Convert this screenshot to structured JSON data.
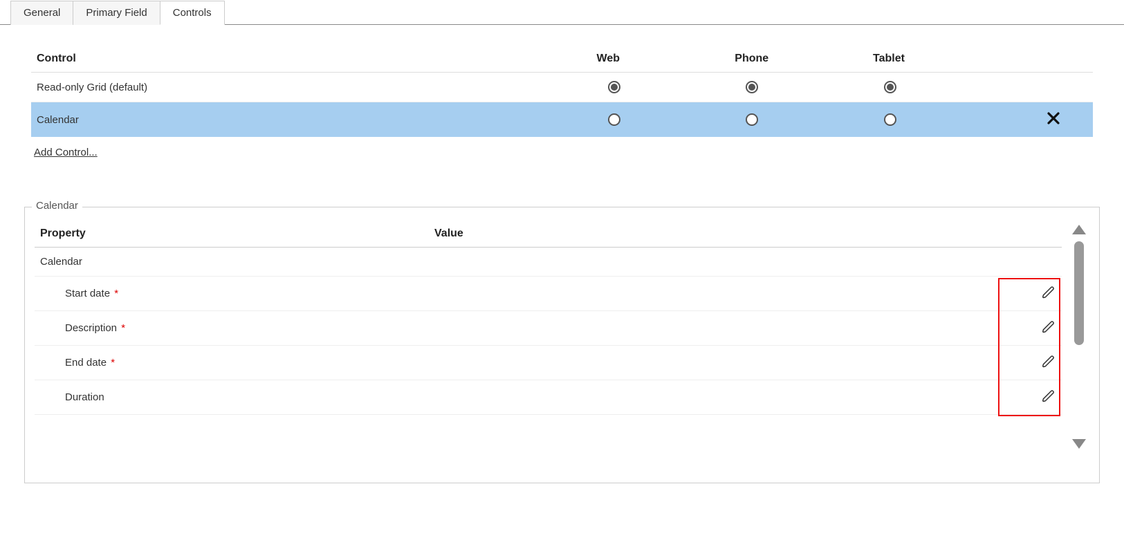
{
  "tabs": {
    "general": "General",
    "primary_field": "Primary Field",
    "controls": "Controls",
    "active": "controls"
  },
  "controls_header": {
    "control": "Control",
    "web": "Web",
    "phone": "Phone",
    "tablet": "Tablet"
  },
  "controls_rows": [
    {
      "name": "Read-only Grid (default)",
      "web": true,
      "phone": true,
      "tablet": true,
      "selected": false,
      "removable": false
    },
    {
      "name": "Calendar",
      "web": false,
      "phone": false,
      "tablet": false,
      "selected": true,
      "removable": true
    }
  ],
  "add_control_link": "Add Control...",
  "section_title": "Calendar",
  "props_header": {
    "property": "Property",
    "value": "Value"
  },
  "props": {
    "group": "Calendar",
    "rows": [
      {
        "label": "Start date",
        "required": true
      },
      {
        "label": "Description",
        "required": true
      },
      {
        "label": "End date",
        "required": true
      },
      {
        "label": "Duration",
        "required": false
      }
    ]
  }
}
